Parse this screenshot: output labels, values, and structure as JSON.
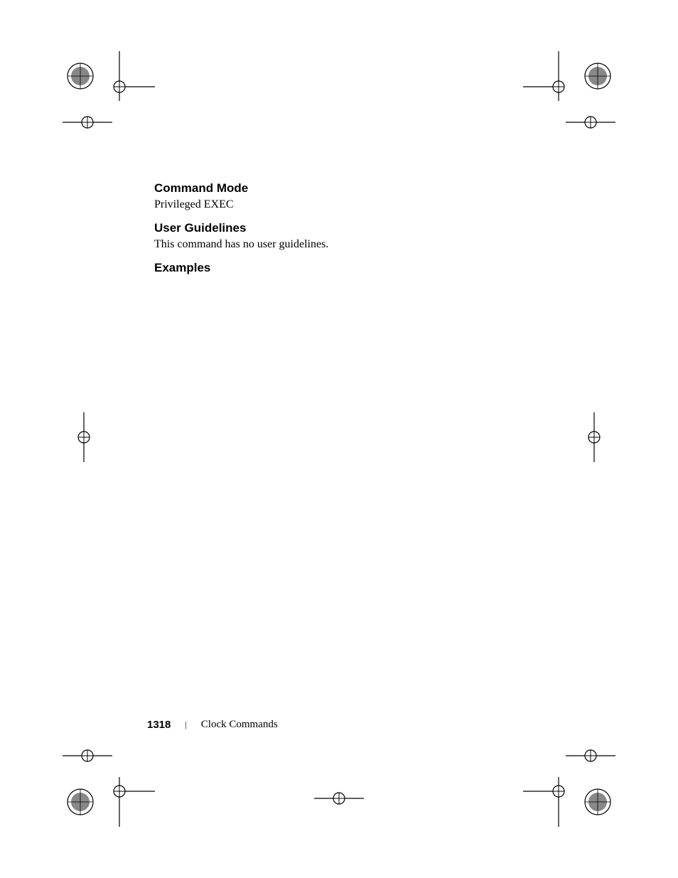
{
  "sections": {
    "commandMode": {
      "heading": "Command Mode",
      "body": "Privileged EXEC"
    },
    "userGuidelines": {
      "heading": "User Guidelines",
      "body": "This command has no user guidelines."
    },
    "examples": {
      "heading": "Examples"
    }
  },
  "footer": {
    "pageNumber": "1318",
    "separator": "|",
    "sectionTitle": "Clock Commands"
  }
}
